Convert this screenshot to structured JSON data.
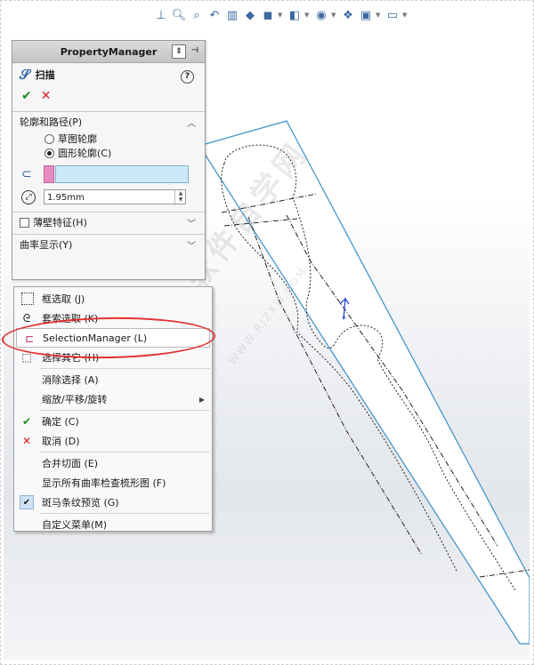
{
  "toolbar": {
    "icons": [
      "view-orient-icon",
      "zoom-fit-icon",
      "zoom-area-icon",
      "previous-view-icon",
      "section-view-icon",
      "view-cube-icon",
      "display-style-icon",
      "hide-show-icon",
      "edit-appearance-icon",
      "scene-icon",
      "view-settings-icon",
      "monitor-icon"
    ]
  },
  "property_manager": {
    "header": "PropertyManager",
    "feature_title": "扫描",
    "sections": {
      "profile_path": "轮廓和路径(P)",
      "thin_feature": "薄壁特征(H)",
      "curvature": "曲率显示(Y)"
    },
    "radio_options": [
      {
        "label": "草图轮廓",
        "selected": false
      },
      {
        "label": "圆形轮廓(C)",
        "selected": true
      }
    ],
    "diameter_value": "1.95mm"
  },
  "context_menu": {
    "items": [
      {
        "label": "框选取 (J)",
        "icon": "box-select-icon"
      },
      {
        "label": "套索选取 (K)",
        "icon": "lasso-select-icon"
      },
      {
        "label": "SelectionManager (L)",
        "icon": "selection-manager-icon"
      },
      {
        "label": "选择其它 (H)",
        "icon": "select-other-icon"
      },
      {
        "label": "消除选择 (A)"
      },
      {
        "label": "缩放/平移/旋转",
        "submenu": true
      },
      {
        "label": "确定 (C)",
        "icon": "ok-icon"
      },
      {
        "label": "取消 (D)",
        "icon": "cancel-icon"
      },
      {
        "label": "合并切面 (E)"
      },
      {
        "label": "显示所有曲率检查梳形图 (F)"
      },
      {
        "label": "斑马条纹预览 (G)",
        "checked": true
      },
      {
        "label": "自定义菜单(M)"
      }
    ]
  },
  "watermark": {
    "cn": "软件自学网",
    "en": "WWW.RJZXW.COM"
  },
  "colors": {
    "annotation": "#e23030",
    "model_edge": "#3a8fc8",
    "selection_field": "#cde8f8",
    "pink_chip": "#ea8ac2"
  }
}
